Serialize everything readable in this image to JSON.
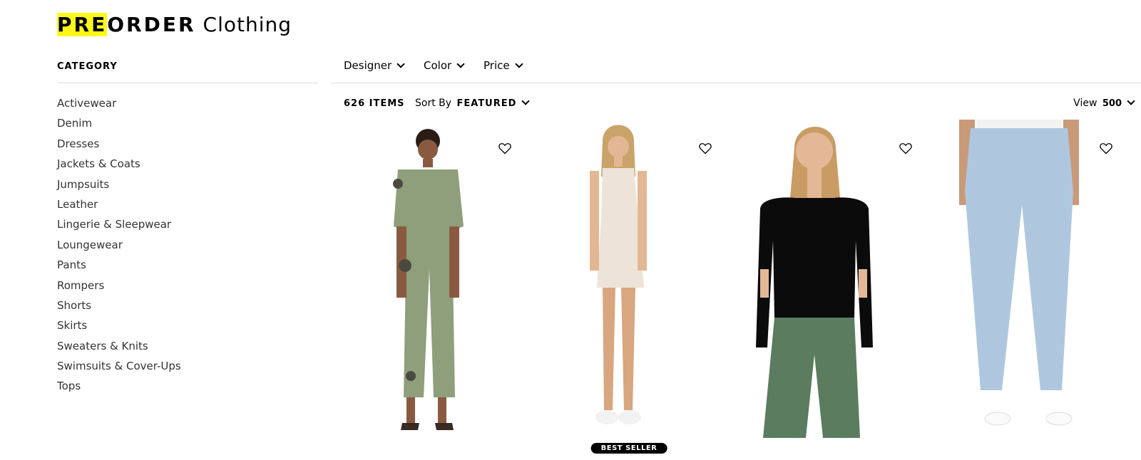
{
  "header": {
    "brand_highlight": "PRE",
    "brand_rest": "ORDER",
    "subtitle": "Clothing"
  },
  "sidebar": {
    "heading": "CATEGORY",
    "items": [
      "Activewear",
      "Denim",
      "Dresses",
      "Jackets & Coats",
      "Jumpsuits",
      "Leather",
      "Lingerie & Sleepwear",
      "Loungewear",
      "Pants",
      "Rompers",
      "Shorts",
      "Skirts",
      "Sweaters & Knits",
      "Swimsuits & Cover-Ups",
      "Tops"
    ]
  },
  "filters": {
    "designer": "Designer",
    "color": "Color",
    "price": "Price"
  },
  "toolbar": {
    "count": "626 ITEMS",
    "sort_label": "Sort By",
    "sort_value": "FEATURED",
    "view_label": "View",
    "view_value": "500"
  },
  "products": [
    {
      "icon": "heart-icon",
      "badge": ""
    },
    {
      "icon": "heart-icon",
      "badge": "BEST SELLER"
    },
    {
      "icon": "heart-icon",
      "badge": ""
    },
    {
      "icon": "heart-icon",
      "badge": ""
    }
  ],
  "colors": {
    "highlight": "#fff71a",
    "badge_bg": "#000000"
  }
}
